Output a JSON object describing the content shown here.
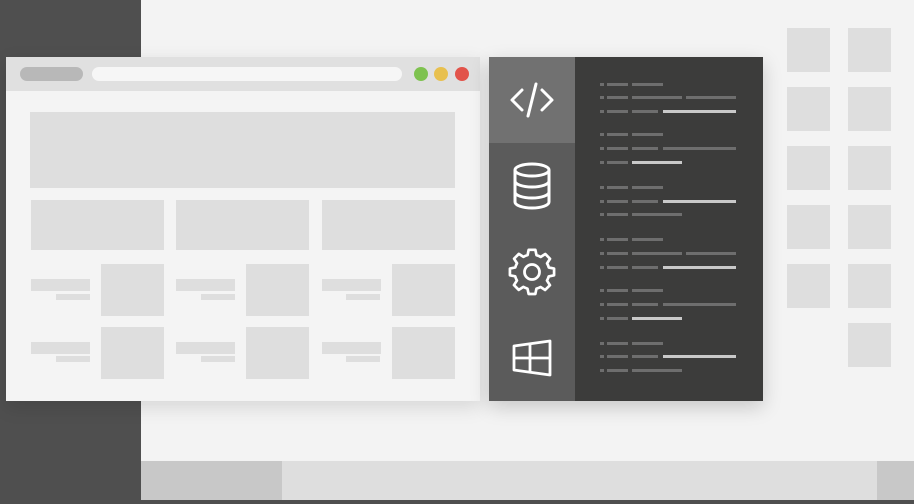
{
  "colors": {
    "desktop": "#f3f3f3",
    "frame": "#4f4f4f",
    "placeholder": "#dedede",
    "traffic_green": "#7ec24f",
    "traffic_yellow": "#e8c04e",
    "traffic_red": "#e2534a",
    "ide_sidebar": "#5b5b5b",
    "ide_sidebar_active": "#717171",
    "ide_editor": "#3c3c3b"
  },
  "ide": {
    "sidebar_icons": [
      "code-icon",
      "database-icon",
      "gear-icon",
      "windows-icon"
    ],
    "active_icon": "code-icon"
  }
}
